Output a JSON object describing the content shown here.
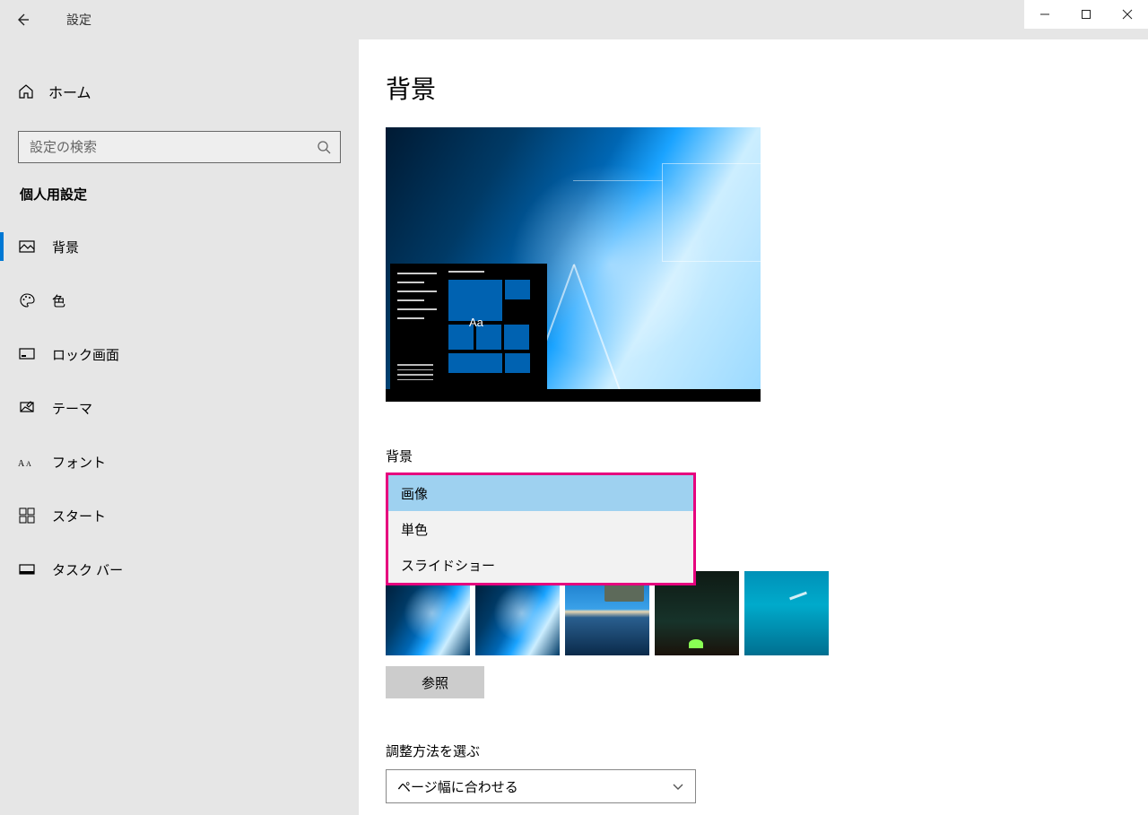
{
  "titlebar": {
    "title": "設定"
  },
  "sidebar": {
    "home": "ホーム",
    "search_placeholder": "設定の検索",
    "category": "個人用設定",
    "items": [
      {
        "label": "背景"
      },
      {
        "label": "色"
      },
      {
        "label": "ロック画面"
      },
      {
        "label": "テーマ"
      },
      {
        "label": "フォント"
      },
      {
        "label": "スタート"
      },
      {
        "label": "タスク バー"
      }
    ]
  },
  "content": {
    "heading": "背景",
    "preview_tile_text": "Aa",
    "bg_label": "背景",
    "dropdown": {
      "options": [
        "画像",
        "単色",
        "スライドショー"
      ]
    },
    "browse": "参照",
    "fit_label": "調整方法を選ぶ",
    "fit_value": "ページ幅に合わせる"
  }
}
